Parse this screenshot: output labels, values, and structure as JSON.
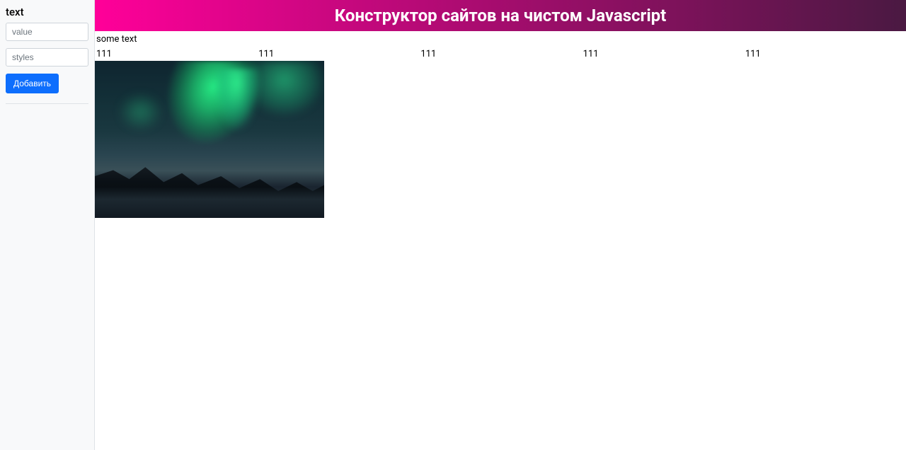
{
  "sidebar": {
    "form_title": "text",
    "value_placeholder": "value",
    "styles_placeholder": "styles",
    "add_button_label": "Добавить"
  },
  "content": {
    "title": "Конструктор сайтов на чистом Javascript",
    "text": "some text",
    "columns": [
      "111",
      "111",
      "111",
      "111",
      "111"
    ]
  }
}
